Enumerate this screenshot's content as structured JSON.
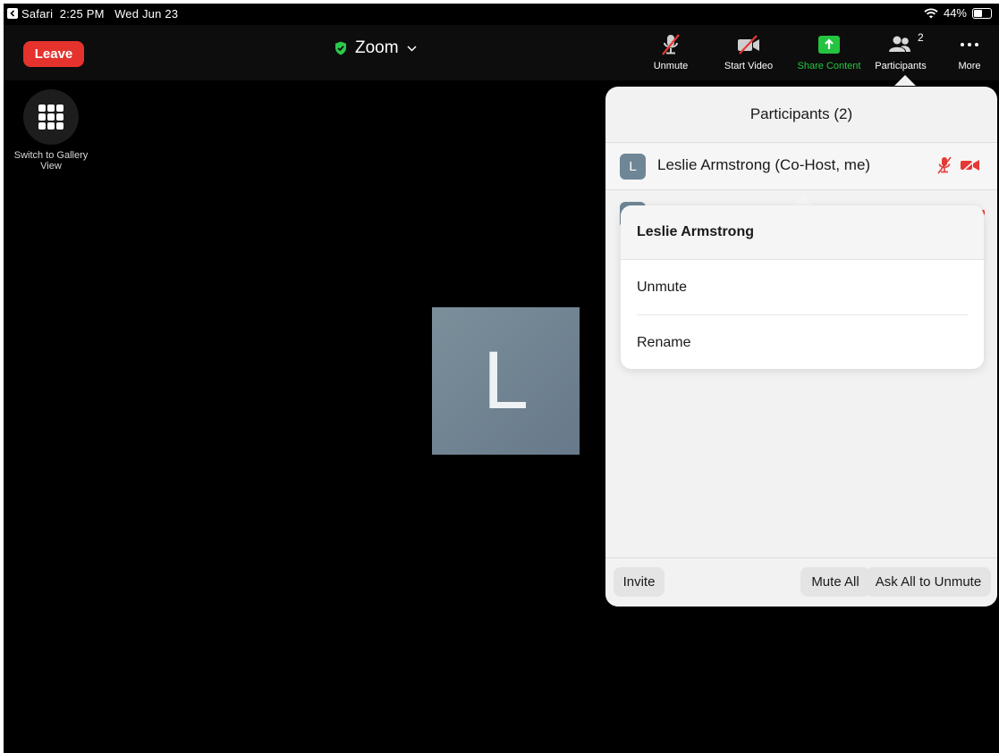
{
  "status_bar": {
    "back_app": "Safari",
    "time": "2:25 PM",
    "date": "Wed Jun 23",
    "battery": "44%",
    "battery_level": 0.44
  },
  "toolbar": {
    "leave_label": "Leave",
    "meeting_title": "Zoom",
    "unmute_label": "Unmute",
    "start_video_label": "Start Video",
    "share_label": "Share Content",
    "participants_label": "Participants",
    "participants_count": "2",
    "more_label": "More"
  },
  "gallery": {
    "label": "Switch to Gallery View"
  },
  "tile": {
    "initial": "L"
  },
  "participants_panel": {
    "title": "Participants (2)",
    "participants": [
      {
        "initial": "L",
        "name": "Leslie Armstrong (Co-Host, me)",
        "muted": true,
        "video_off": true
      }
    ],
    "popover": {
      "title": "Leslie Armstrong",
      "items": [
        "Unmute",
        "Rename"
      ]
    },
    "footer": {
      "invite": "Invite",
      "mute_all": "Mute All",
      "ask_all": "Ask All to Unmute"
    }
  },
  "colors": {
    "leave": "#e5322d",
    "share": "#25c440",
    "muted_icon": "#e53935",
    "avatar": "#6f8696"
  },
  "icons": [
    "chevron-back-icon",
    "wifi-icon",
    "battery-icon",
    "shield-check-icon",
    "chevron-down-icon",
    "mic-muted-icon",
    "video-off-icon",
    "share-arrow-icon",
    "participants-icon",
    "more-dots-icon",
    "grid-icon"
  ]
}
